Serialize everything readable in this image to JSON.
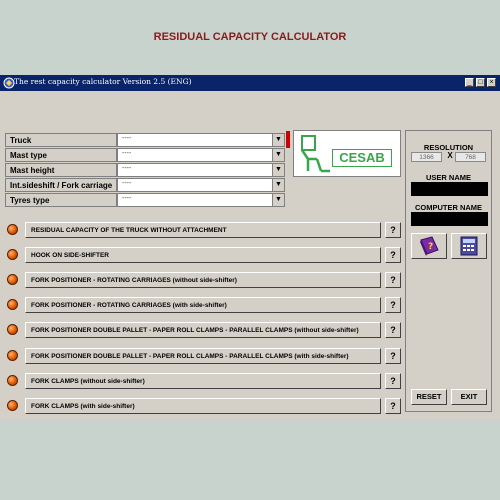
{
  "window": {
    "title": "The rest capacity calculator Version 2.5 (ENG)",
    "controls": [
      "_",
      "□",
      "×"
    ]
  },
  "app_title": "RESIDUAL CAPACITY CALCULATOR",
  "params": [
    {
      "label": "Truck",
      "value": "----"
    },
    {
      "label": "Mast type",
      "value": "----"
    },
    {
      "label": "Mast height",
      "value": "----"
    },
    {
      "label": "Int.sideshift / Fork carriage",
      "value": "----"
    },
    {
      "label": "Tyres type",
      "value": "----"
    }
  ],
  "logo": {
    "text": "CESAB"
  },
  "right_panel": {
    "resolution_label": "RESOLUTION",
    "res_width": "1366",
    "res_sep": "X",
    "res_height": "768",
    "user_name_label": "USER NAME",
    "computer_name_label": "COMPUTER NAME",
    "reset_label": "RESET",
    "exit_label": "EXIT"
  },
  "options": [
    {
      "label": "RESIDUAL CAPACITY OF THE TRUCK WITHOUT ATTACHMENT",
      "help": "?"
    },
    {
      "label": "HOOK ON SIDE-SHIFTER",
      "help": "?"
    },
    {
      "label": "FORK POSITIONER - ROTATING CARRIAGES (without side-shifter)",
      "help": "?"
    },
    {
      "label": "FORK POSITIONER - ROTATING CARRIAGES (with side-shifter)",
      "help": "?"
    },
    {
      "label": "FORK POSITIONER DOUBLE PALLET - PAPER ROLL CLAMPS - PARALLEL CLAMPS (without side-shifter)",
      "help": "?"
    },
    {
      "label": "FORK POSITIONER DOUBLE PALLET - PAPER ROLL CLAMPS - PARALLEL CLAMPS (with side-shifter)",
      "help": "?"
    },
    {
      "label": "FORK CLAMPS (without side-shifter)",
      "help": "?"
    },
    {
      "label": "FORK CLAMPS (with side-shifter)",
      "help": "?"
    }
  ],
  "icons": [
    "app-icon",
    "help-book-icon",
    "calculator-icon",
    "radio-bullet-icon",
    "dropdown-arrow-icon"
  ]
}
